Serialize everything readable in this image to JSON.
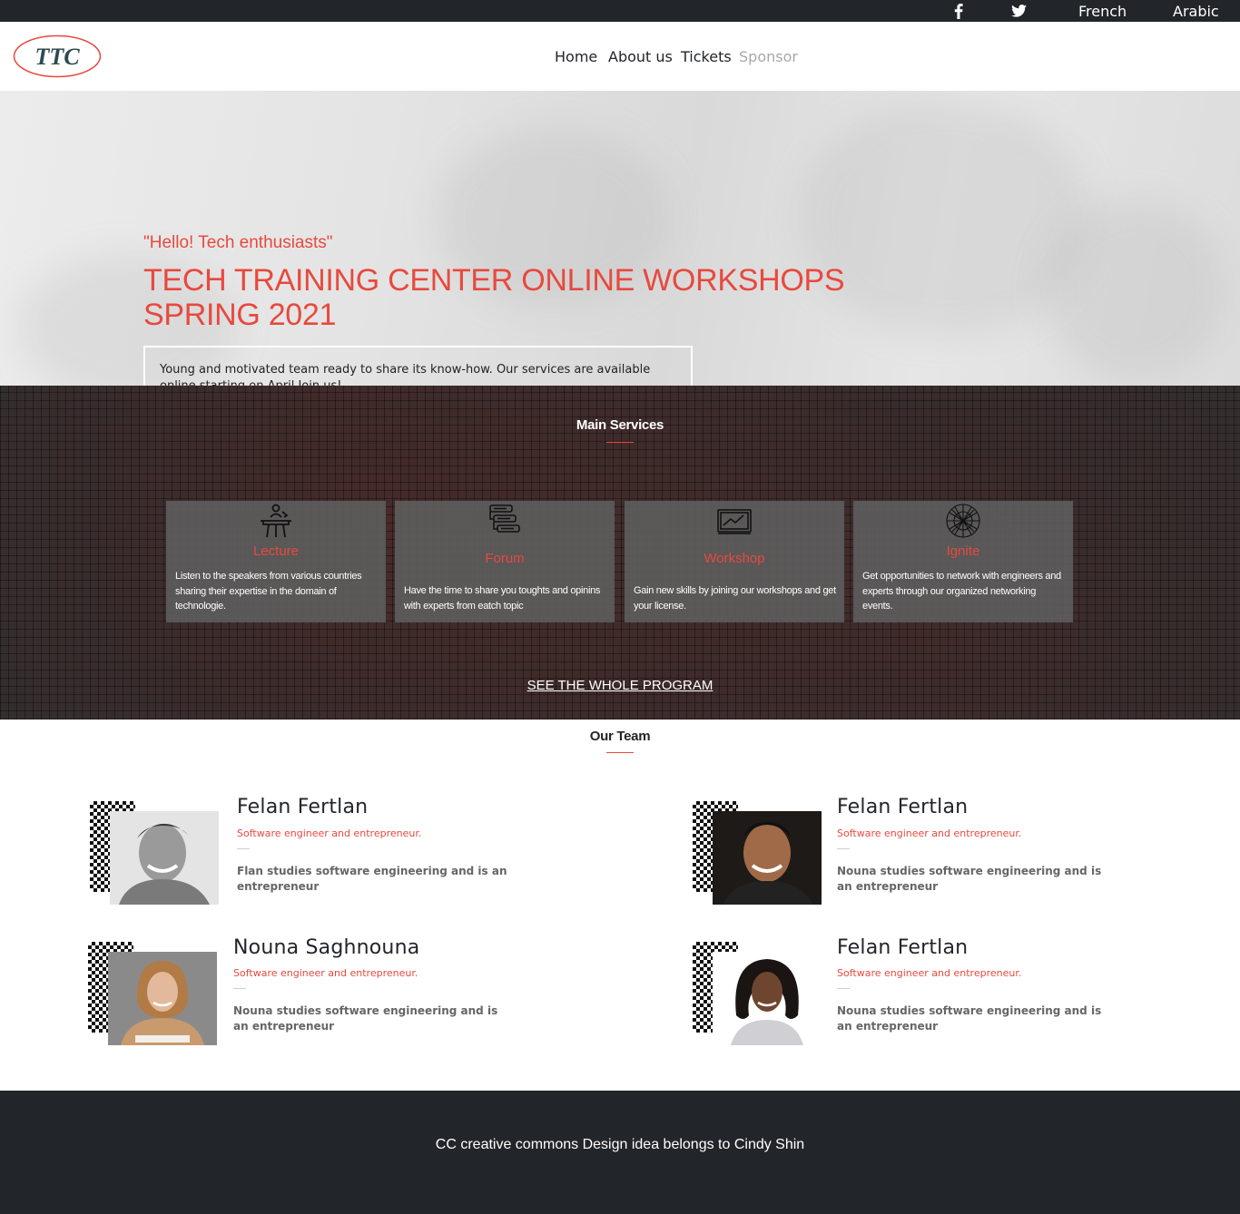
{
  "topbar": {
    "facebook_icon": "facebook-icon",
    "twitter_icon": "twitter-icon",
    "lang_french": "French",
    "lang_arabic": "Arabic"
  },
  "header": {
    "logo_text": "TTC",
    "nav": {
      "home": "Home",
      "about": "About us",
      "tickets": "Tickets",
      "sponsor": "Sponsor"
    }
  },
  "hero": {
    "greeting": "\"Hello! Tech enthusiasts\"",
    "title": "TECH TRAINING CENTER ONLINE WORKSHOPS SPRING 2021",
    "description": "Young and motivated team ready to share its know-how. Our services are available online starting on April Join us!"
  },
  "services": {
    "title": "Main Services",
    "cards": [
      {
        "icon": "lecture-desk-icon",
        "title": "Lecture",
        "description": "Listen to the speakers from various countries sharing their expertise in the domain of technologie."
      },
      {
        "icon": "forum-stack-icon",
        "title": "Forum",
        "description": "Have the time to share you toughts and opinins with experts from eatch topic"
      },
      {
        "icon": "workshop-board-icon",
        "title": "Workshop",
        "description": "Gain new skills by joining our workshops and get your license."
      },
      {
        "icon": "ignite-globe-icon",
        "title": "Ignite",
        "description": "Get opportunities to network with engineers and experts through our organized networking events."
      }
    ],
    "program_link": "SEE THE WHOLE PROGRAM"
  },
  "team": {
    "title": "Our Team",
    "members": [
      {
        "name": "Felan Fertlan",
        "role": "Software engineer and entrepreneur.",
        "bio": "Flan studies software engineering and is an entrepreneur"
      },
      {
        "name": "Felan Fertlan",
        "role": "Software engineer and entrepreneur.",
        "bio": "Nouna studies software engineering and is an entrepreneur"
      },
      {
        "name": "Nouna Saghnouna",
        "role": "Software engineer and entrepreneur.",
        "bio": "Nouna studies software engineering and is an entrepreneur"
      },
      {
        "name": "Felan Fertlan",
        "role": "Software engineer and entrepreneur.",
        "bio": "Nouna studies software engineering and is an entrepreneur"
      }
    ]
  },
  "footer": {
    "text": "CC creative commons Design idea belongs to Cindy Shin"
  },
  "colors": {
    "accent": "#e8493e",
    "dark": "#22252a",
    "nav_muted": "#a8a8a8"
  }
}
